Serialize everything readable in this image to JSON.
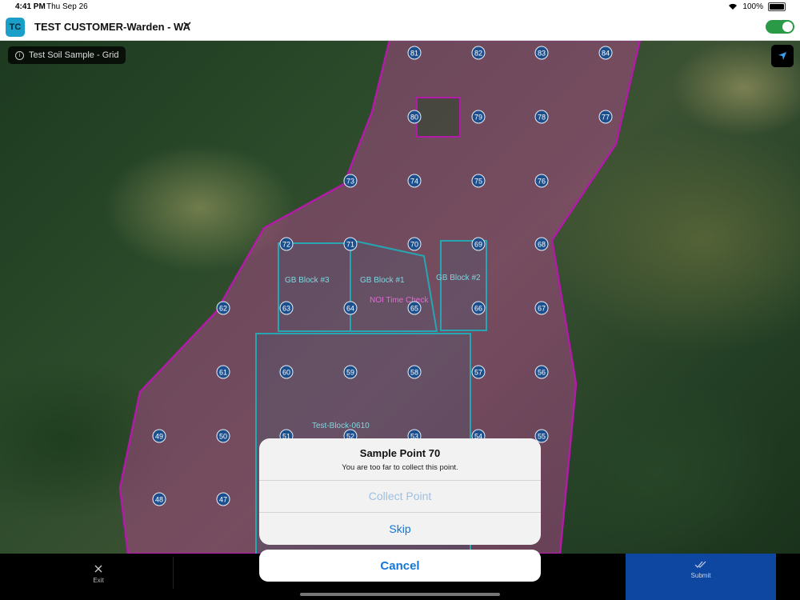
{
  "status_bar": {
    "time": "4:41 PM",
    "date": "Thu Sep 26",
    "battery": "100%"
  },
  "header": {
    "avatar": "TC",
    "customer": "TEST CUSTOMER-Warden - WA"
  },
  "map": {
    "sample_chip": "Test Soil Sample - Grid",
    "blocks": [
      "GB Block #3",
      "GB Block #1",
      "GB Block #2",
      "NOI Time Check",
      "Test-Block-0610"
    ],
    "points": [
      "81",
      "82",
      "83",
      "84",
      "80",
      "79",
      "78",
      "77",
      "73",
      "74",
      "75",
      "76",
      "72",
      "71",
      "70",
      "69",
      "68",
      "62",
      "63",
      "64",
      "65",
      "66",
      "67",
      "61",
      "60",
      "59",
      "58",
      "57",
      "56",
      "49",
      "50",
      "51",
      "52",
      "53",
      "54",
      "55",
      "48",
      "47"
    ]
  },
  "toolbar": {
    "exit": "Exit",
    "submit": "Submit"
  },
  "dialog": {
    "title": "Sample Point 70",
    "message": "You are too far to collect this point.",
    "collect": "Collect Point",
    "skip": "Skip",
    "cancel": "Cancel"
  },
  "colors": {
    "field_border": "#b21aa8",
    "field_fill": "rgba(190,70,150,0.45)",
    "block_border": "#26a6b2",
    "point_fill": "#1d4f8c",
    "accent": "#1476d6"
  }
}
